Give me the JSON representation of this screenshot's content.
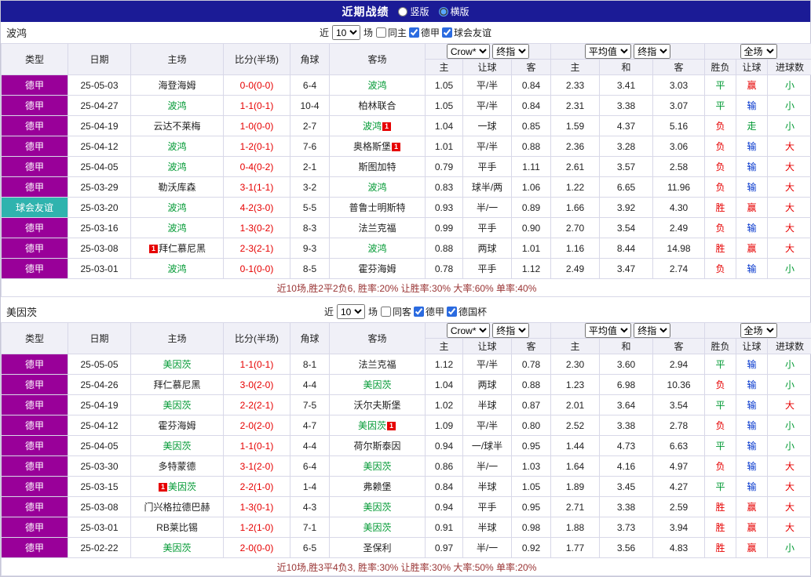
{
  "topbar": {
    "title": "近期战绩",
    "radio_vertical": "竖版",
    "radio_horizontal": "横版",
    "selected_layout": "横版"
  },
  "colors": {
    "topbar_bg": "#1B1B96",
    "league_bg": "#990099",
    "friendly_bg": "#2FB3AE",
    "header_bg": "#F0F0F7",
    "green": "#009933",
    "red": "#E60000",
    "blue": "#0033CC",
    "border": "#D8D8E8",
    "summary": "#993333"
  },
  "sections": [
    {
      "team": "波鸿",
      "controls": {
        "near_label": "近",
        "count": "10",
        "games_label": "场",
        "checkboxes": [
          {
            "label": "同主",
            "checked": false
          },
          {
            "label": "德甲",
            "checked": true
          },
          {
            "label": "球会友谊",
            "checked": true
          }
        ]
      },
      "header": {
        "cols": [
          "类型",
          "日期",
          "主场",
          "比分(半场)",
          "角球",
          "客场"
        ],
        "odds_select": "Crow*",
        "odds_final": "终指",
        "avg_select": "平均值",
        "avg_final": "终指",
        "full_select": "全场",
        "sub": [
          "主",
          "让球",
          "客",
          "主",
          "和",
          "客",
          "胜负",
          "让球",
          "进球数"
        ]
      },
      "rows": [
        {
          "league": "德甲",
          "lg": "league",
          "date": "25-05-03",
          "home": {
            "name": "海登海姆",
            "focus": false
          },
          "score": "0-0(0-0)",
          "corner": "6-4",
          "away": {
            "name": "波鸿",
            "focus": true
          },
          "odds": [
            "1.05",
            "平/半",
            "0.84"
          ],
          "avg": [
            "2.33",
            "3.41",
            "3.03"
          ],
          "wdl": {
            "t": "平",
            "c": "green"
          },
          "let": {
            "t": "赢",
            "c": "red"
          },
          "goal": {
            "t": "小",
            "c": "green"
          }
        },
        {
          "league": "德甲",
          "lg": "league",
          "date": "25-04-27",
          "home": {
            "name": "波鸿",
            "focus": true
          },
          "score": "1-1(0-1)",
          "corner": "10-4",
          "away": {
            "name": "柏林联合",
            "focus": false
          },
          "odds": [
            "1.05",
            "平/半",
            "0.84"
          ],
          "avg": [
            "2.31",
            "3.38",
            "3.07"
          ],
          "wdl": {
            "t": "平",
            "c": "green"
          },
          "let": {
            "t": "输",
            "c": "blue"
          },
          "goal": {
            "t": "小",
            "c": "green"
          }
        },
        {
          "league": "德甲",
          "lg": "league",
          "date": "25-04-19",
          "home": {
            "name": "云达不莱梅",
            "focus": false
          },
          "score": "1-0(0-0)",
          "corner": "2-7",
          "away": {
            "name": "波鸿",
            "focus": true,
            "badge": {
              "pos": "after",
              "t": "1"
            }
          },
          "odds": [
            "1.04",
            "一球",
            "0.85"
          ],
          "avg": [
            "1.59",
            "4.37",
            "5.16"
          ],
          "wdl": {
            "t": "负",
            "c": "red"
          },
          "let": {
            "t": "走",
            "c": "green"
          },
          "goal": {
            "t": "小",
            "c": "green"
          }
        },
        {
          "league": "德甲",
          "lg": "league",
          "date": "25-04-12",
          "home": {
            "name": "波鸿",
            "focus": true
          },
          "score": "1-2(0-1)",
          "corner": "7-6",
          "away": {
            "name": "奥格斯堡",
            "focus": false,
            "badge": {
              "pos": "after",
              "t": "1"
            }
          },
          "odds": [
            "1.01",
            "平/半",
            "0.88"
          ],
          "avg": [
            "2.36",
            "3.28",
            "3.06"
          ],
          "wdl": {
            "t": "负",
            "c": "red"
          },
          "let": {
            "t": "输",
            "c": "blue"
          },
          "goal": {
            "t": "大",
            "c": "red"
          }
        },
        {
          "league": "德甲",
          "lg": "league",
          "date": "25-04-05",
          "home": {
            "name": "波鸿",
            "focus": true
          },
          "score": "0-4(0-2)",
          "corner": "2-1",
          "away": {
            "name": "斯图加特",
            "focus": false
          },
          "odds": [
            "0.79",
            "平手",
            "1.11"
          ],
          "avg": [
            "2.61",
            "3.57",
            "2.58"
          ],
          "wdl": {
            "t": "负",
            "c": "red"
          },
          "let": {
            "t": "输",
            "c": "blue"
          },
          "goal": {
            "t": "大",
            "c": "red"
          }
        },
        {
          "league": "德甲",
          "lg": "league",
          "date": "25-03-29",
          "home": {
            "name": "勒沃库森",
            "focus": false
          },
          "score": "3-1(1-1)",
          "corner": "3-2",
          "away": {
            "name": "波鸿",
            "focus": true
          },
          "odds": [
            "0.83",
            "球半/两",
            "1.06"
          ],
          "avg": [
            "1.22",
            "6.65",
            "11.96"
          ],
          "wdl": {
            "t": "负",
            "c": "red"
          },
          "let": {
            "t": "输",
            "c": "blue"
          },
          "goal": {
            "t": "大",
            "c": "red"
          }
        },
        {
          "league": "球会友谊",
          "lg": "friendly",
          "date": "25-03-20",
          "home": {
            "name": "波鸿",
            "focus": true
          },
          "score": "4-2(3-0)",
          "corner": "5-5",
          "away": {
            "name": "普鲁士明斯特",
            "focus": false
          },
          "odds": [
            "0.93",
            "半/一",
            "0.89"
          ],
          "avg": [
            "1.66",
            "3.92",
            "4.30"
          ],
          "wdl": {
            "t": "胜",
            "c": "red"
          },
          "let": {
            "t": "赢",
            "c": "red"
          },
          "goal": {
            "t": "大",
            "c": "red"
          }
        },
        {
          "league": "德甲",
          "lg": "league",
          "date": "25-03-16",
          "home": {
            "name": "波鸿",
            "focus": true
          },
          "score": "1-3(0-2)",
          "corner": "8-3",
          "away": {
            "name": "法兰克福",
            "focus": false
          },
          "odds": [
            "0.99",
            "平手",
            "0.90"
          ],
          "avg": [
            "2.70",
            "3.54",
            "2.49"
          ],
          "wdl": {
            "t": "负",
            "c": "red"
          },
          "let": {
            "t": "输",
            "c": "blue"
          },
          "goal": {
            "t": "大",
            "c": "red"
          }
        },
        {
          "league": "德甲",
          "lg": "league",
          "date": "25-03-08",
          "home": {
            "name": "拜仁慕尼黑",
            "focus": false,
            "badge": {
              "pos": "before",
              "t": "1"
            }
          },
          "score": "2-3(2-1)",
          "corner": "9-3",
          "away": {
            "name": "波鸿",
            "focus": true
          },
          "odds": [
            "0.88",
            "两球",
            "1.01"
          ],
          "avg": [
            "1.16",
            "8.44",
            "14.98"
          ],
          "wdl": {
            "t": "胜",
            "c": "red"
          },
          "let": {
            "t": "赢",
            "c": "red"
          },
          "goal": {
            "t": "大",
            "c": "red"
          }
        },
        {
          "league": "德甲",
          "lg": "league",
          "date": "25-03-01",
          "home": {
            "name": "波鸿",
            "focus": true
          },
          "score": "0-1(0-0)",
          "corner": "8-5",
          "away": {
            "name": "霍芬海姆",
            "focus": false
          },
          "odds": [
            "0.78",
            "平手",
            "1.12"
          ],
          "avg": [
            "2.49",
            "3.47",
            "2.74"
          ],
          "wdl": {
            "t": "负",
            "c": "red"
          },
          "let": {
            "t": "输",
            "c": "blue"
          },
          "goal": {
            "t": "小",
            "c": "green"
          }
        }
      ],
      "summary": "近10场,胜2平2负6, 胜率:20% 让胜率:30% 大率:60% 单率:40%"
    },
    {
      "team": "美因茨",
      "controls": {
        "near_label": "近",
        "count": "10",
        "games_label": "场",
        "checkboxes": [
          {
            "label": "同客",
            "checked": false
          },
          {
            "label": "德甲",
            "checked": true
          },
          {
            "label": "德国杯",
            "checked": true
          }
        ]
      },
      "header": {
        "cols": [
          "类型",
          "日期",
          "主场",
          "比分(半场)",
          "角球",
          "客场"
        ],
        "odds_select": "Crow*",
        "odds_final": "终指",
        "avg_select": "平均值",
        "avg_final": "终指",
        "full_select": "全场",
        "sub": [
          "主",
          "让球",
          "客",
          "主",
          "和",
          "客",
          "胜负",
          "让球",
          "进球数"
        ]
      },
      "rows": [
        {
          "league": "德甲",
          "lg": "league",
          "date": "25-05-05",
          "home": {
            "name": "美因茨",
            "focus": true
          },
          "score": "1-1(0-1)",
          "corner": "8-1",
          "away": {
            "name": "法兰克福",
            "focus": false
          },
          "odds": [
            "1.12",
            "平/半",
            "0.78"
          ],
          "avg": [
            "2.30",
            "3.60",
            "2.94"
          ],
          "wdl": {
            "t": "平",
            "c": "green"
          },
          "let": {
            "t": "输",
            "c": "blue"
          },
          "goal": {
            "t": "小",
            "c": "green"
          }
        },
        {
          "league": "德甲",
          "lg": "league",
          "date": "25-04-26",
          "home": {
            "name": "拜仁慕尼黑",
            "focus": false
          },
          "score": "3-0(2-0)",
          "corner": "4-4",
          "away": {
            "name": "美因茨",
            "focus": true
          },
          "odds": [
            "1.04",
            "两球",
            "0.88"
          ],
          "avg": [
            "1.23",
            "6.98",
            "10.36"
          ],
          "wdl": {
            "t": "负",
            "c": "red"
          },
          "let": {
            "t": "输",
            "c": "blue"
          },
          "goal": {
            "t": "小",
            "c": "green"
          }
        },
        {
          "league": "德甲",
          "lg": "league",
          "date": "25-04-19",
          "home": {
            "name": "美因茨",
            "focus": true
          },
          "score": "2-2(2-1)",
          "corner": "7-5",
          "away": {
            "name": "沃尔夫斯堡",
            "focus": false
          },
          "odds": [
            "1.02",
            "半球",
            "0.87"
          ],
          "avg": [
            "2.01",
            "3.64",
            "3.54"
          ],
          "wdl": {
            "t": "平",
            "c": "green"
          },
          "let": {
            "t": "输",
            "c": "blue"
          },
          "goal": {
            "t": "大",
            "c": "red"
          }
        },
        {
          "league": "德甲",
          "lg": "league",
          "date": "25-04-12",
          "home": {
            "name": "霍芬海姆",
            "focus": false
          },
          "score": "2-0(2-0)",
          "corner": "4-7",
          "away": {
            "name": "美因茨",
            "focus": true,
            "badge": {
              "pos": "after",
              "t": "1"
            }
          },
          "odds": [
            "1.09",
            "平/半",
            "0.80"
          ],
          "avg": [
            "2.52",
            "3.38",
            "2.78"
          ],
          "wdl": {
            "t": "负",
            "c": "red"
          },
          "let": {
            "t": "输",
            "c": "blue"
          },
          "goal": {
            "t": "小",
            "c": "green"
          }
        },
        {
          "league": "德甲",
          "lg": "league",
          "date": "25-04-05",
          "home": {
            "name": "美因茨",
            "focus": true
          },
          "score": "1-1(0-1)",
          "corner": "4-4",
          "away": {
            "name": "荷尔斯泰因",
            "focus": false
          },
          "odds": [
            "0.94",
            "一/球半",
            "0.95"
          ],
          "avg": [
            "1.44",
            "4.73",
            "6.63"
          ],
          "wdl": {
            "t": "平",
            "c": "green"
          },
          "let": {
            "t": "输",
            "c": "blue"
          },
          "goal": {
            "t": "小",
            "c": "green"
          }
        },
        {
          "league": "德甲",
          "lg": "league",
          "date": "25-03-30",
          "home": {
            "name": "多特蒙德",
            "focus": false
          },
          "score": "3-1(2-0)",
          "corner": "6-4",
          "away": {
            "name": "美因茨",
            "focus": true
          },
          "odds": [
            "0.86",
            "半/一",
            "1.03"
          ],
          "avg": [
            "1.64",
            "4.16",
            "4.97"
          ],
          "wdl": {
            "t": "负",
            "c": "red"
          },
          "let": {
            "t": "输",
            "c": "blue"
          },
          "goal": {
            "t": "大",
            "c": "red"
          }
        },
        {
          "league": "德甲",
          "lg": "league",
          "date": "25-03-15",
          "home": {
            "name": "美因茨",
            "focus": true,
            "badge": {
              "pos": "before",
              "t": "1"
            }
          },
          "score": "2-2(1-0)",
          "corner": "1-4",
          "away": {
            "name": "弗赖堡",
            "focus": false
          },
          "odds": [
            "0.84",
            "半球",
            "1.05"
          ],
          "avg": [
            "1.89",
            "3.45",
            "4.27"
          ],
          "wdl": {
            "t": "平",
            "c": "green"
          },
          "let": {
            "t": "输",
            "c": "blue"
          },
          "goal": {
            "t": "大",
            "c": "red"
          }
        },
        {
          "league": "德甲",
          "lg": "league",
          "date": "25-03-08",
          "home": {
            "name": "门兴格拉德巴赫",
            "focus": false
          },
          "score": "1-3(0-1)",
          "corner": "4-3",
          "away": {
            "name": "美因茨",
            "focus": true
          },
          "odds": [
            "0.94",
            "平手",
            "0.95"
          ],
          "avg": [
            "2.71",
            "3.38",
            "2.59"
          ],
          "wdl": {
            "t": "胜",
            "c": "red"
          },
          "let": {
            "t": "赢",
            "c": "red"
          },
          "goal": {
            "t": "大",
            "c": "red"
          }
        },
        {
          "league": "德甲",
          "lg": "league",
          "date": "25-03-01",
          "home": {
            "name": "RB莱比锡",
            "focus": false
          },
          "score": "1-2(1-0)",
          "corner": "7-1",
          "away": {
            "name": "美因茨",
            "focus": true
          },
          "odds": [
            "0.91",
            "半球",
            "0.98"
          ],
          "avg": [
            "1.88",
            "3.73",
            "3.94"
          ],
          "wdl": {
            "t": "胜",
            "c": "red"
          },
          "let": {
            "t": "赢",
            "c": "red"
          },
          "goal": {
            "t": "大",
            "c": "red"
          }
        },
        {
          "league": "德甲",
          "lg": "league",
          "date": "25-02-22",
          "home": {
            "name": "美因茨",
            "focus": true
          },
          "score": "2-0(0-0)",
          "corner": "6-5",
          "away": {
            "name": "圣保利",
            "focus": false
          },
          "odds": [
            "0.97",
            "半/一",
            "0.92"
          ],
          "avg": [
            "1.77",
            "3.56",
            "4.83"
          ],
          "wdl": {
            "t": "胜",
            "c": "red"
          },
          "let": {
            "t": "赢",
            "c": "red"
          },
          "goal": {
            "t": "小",
            "c": "green"
          }
        }
      ],
      "summary": "近10场,胜3平4负3, 胜率:30% 让胜率:30% 大率:50% 单率:20%"
    }
  ]
}
